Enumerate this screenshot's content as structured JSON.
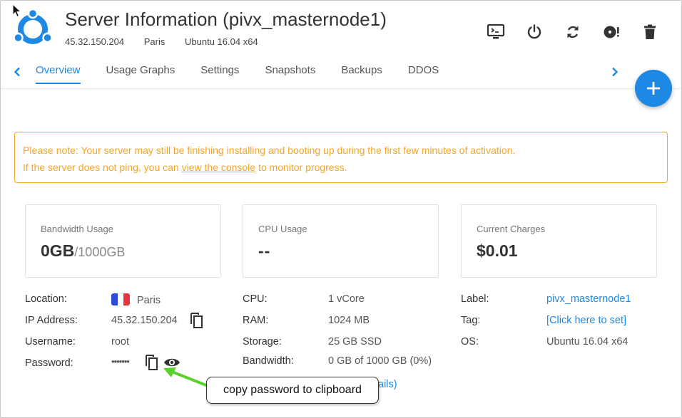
{
  "header": {
    "title": "Server Information (pivx_masternode1)",
    "ip": "45.32.150.204",
    "location": "Paris",
    "os": "Ubuntu 16.04 x64"
  },
  "toolbar": {
    "icons": [
      "console-icon",
      "power-icon",
      "restart-icon",
      "reinstall-icon",
      "trash-icon"
    ]
  },
  "tabs": [
    {
      "label": "Overview",
      "active": true
    },
    {
      "label": "Usage Graphs"
    },
    {
      "label": "Settings"
    },
    {
      "label": "Snapshots"
    },
    {
      "label": "Backups"
    },
    {
      "label": "DDOS"
    }
  ],
  "notice": {
    "line1": "Please note: Your server may still be finishing installing and booting up during the first few minutes of activation.",
    "line2_prefix": "If the server does not ping, you can ",
    "line2_link": "view the console",
    "line2_suffix": " to monitor progress."
  },
  "cards": {
    "bandwidth": {
      "label": "Bandwidth Usage",
      "value": "0GB",
      "unit": "/1000GB"
    },
    "cpu": {
      "label": "CPU Usage",
      "value": "--"
    },
    "charges": {
      "label": "Current Charges",
      "value": "$0.01"
    }
  },
  "details": {
    "location_label": "Location:",
    "location_value": "Paris",
    "ip_label": "IP Address:",
    "ip_value": "45.32.150.204",
    "username_label": "Username:",
    "username_value": "root",
    "password_label": "Password:",
    "password_value": "•••••••",
    "cpu_label": "CPU:",
    "cpu_value": "1 vCore",
    "ram_label": "RAM:",
    "ram_value": "1024 MB",
    "storage_label": "Storage:",
    "storage_value": "25 GB SSD",
    "bandwidth_label": "Bandwidth:",
    "bandwidth_value": "0 GB of 1000 GB (0%)",
    "details_link_tail": "ails)",
    "label_label": "Label:",
    "label_value": "pivx_masternode1",
    "tag_label": "Tag:",
    "tag_value": "[Click here to set]",
    "os_label": "OS:",
    "os_value": "Ubuntu 16.04 x64"
  },
  "callout": {
    "text": "copy password to clipboard"
  },
  "colors": {
    "accent": "#1e88e5",
    "notice": "#f5a623",
    "arrow": "#5cd12e",
    "flag": [
      "#2d4bd8",
      "#ffffff",
      "#e8343f"
    ]
  }
}
